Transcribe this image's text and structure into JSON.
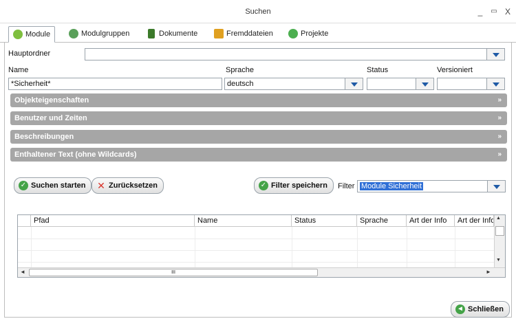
{
  "window": {
    "title": "Suchen",
    "minimize_glyph": "_",
    "maximize_glyph": "▭",
    "close_glyph": "X"
  },
  "tabs": [
    {
      "label": "Module",
      "icon": "module-icon",
      "color": "#7fbf3f"
    },
    {
      "label": "Modulgruppen",
      "icon": "modulgruppen-icon",
      "color": "#5aa05a"
    },
    {
      "label": "Dokumente",
      "icon": "dokumente-icon",
      "color": "#3c7a2a"
    },
    {
      "label": "Fremddateien",
      "icon": "fremddateien-icon",
      "color": "#e0a020"
    },
    {
      "label": "Projekte",
      "icon": "projekte-icon",
      "color": "#4caf50"
    }
  ],
  "form": {
    "hauptordner_label": "Hauptordner",
    "hauptordner_value": "",
    "name_label": "Name",
    "name_value": "*Sicherheit*",
    "sprache_label": "Sprache",
    "sprache_value": "deutsch",
    "status_label": "Status",
    "status_value": "",
    "versioniert_label": "Versioniert",
    "versioniert_value": ""
  },
  "sections": [
    {
      "label": "Objekteigenschaften"
    },
    {
      "label": "Benutzer und Zeiten"
    },
    {
      "label": "Beschreibungen"
    },
    {
      "label": "Enthaltener Text (ohne Wildcards)"
    }
  ],
  "section_chevron": "»",
  "actions": {
    "search_label": "Suchen starten",
    "reset_label": "Zurücksetzen",
    "save_filter_label": "Filter speichern",
    "filter_label": "Filter",
    "filter_value": "Module Sicherheit"
  },
  "table": {
    "columns": [
      "Pfad",
      "Name",
      "Status",
      "Sprache",
      "Art der Info",
      "Art der Info"
    ],
    "rows": []
  },
  "scrollbar": {
    "up": "▲",
    "down": "▼",
    "left": "◄",
    "right": "►",
    "grip": "III"
  },
  "footer": {
    "close_label": "Schließen"
  },
  "colors": {
    "accent_blue": "#1f5aa6",
    "section_gray": "#a6a6a6",
    "green_icon": "#44a348",
    "red_icon": "#d9342b",
    "selection": "#2f6fd6"
  }
}
